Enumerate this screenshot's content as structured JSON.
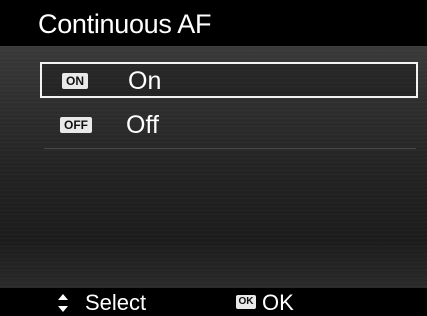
{
  "header": {
    "title": "Continuous AF"
  },
  "options": [
    {
      "badge": "ON",
      "label": "On",
      "selected": true
    },
    {
      "badge": "OFF",
      "label": "Off",
      "selected": false
    }
  ],
  "footer": {
    "nav_icon": "up-down-arrows-icon",
    "select_label": "Select",
    "ok_icon_text": "OK",
    "ok_label": "OK"
  },
  "colors": {
    "background": "#000000",
    "text": "#ffffff",
    "badge_bg": "#e9e9e9",
    "highlight_border": "#f2f2f2"
  }
}
